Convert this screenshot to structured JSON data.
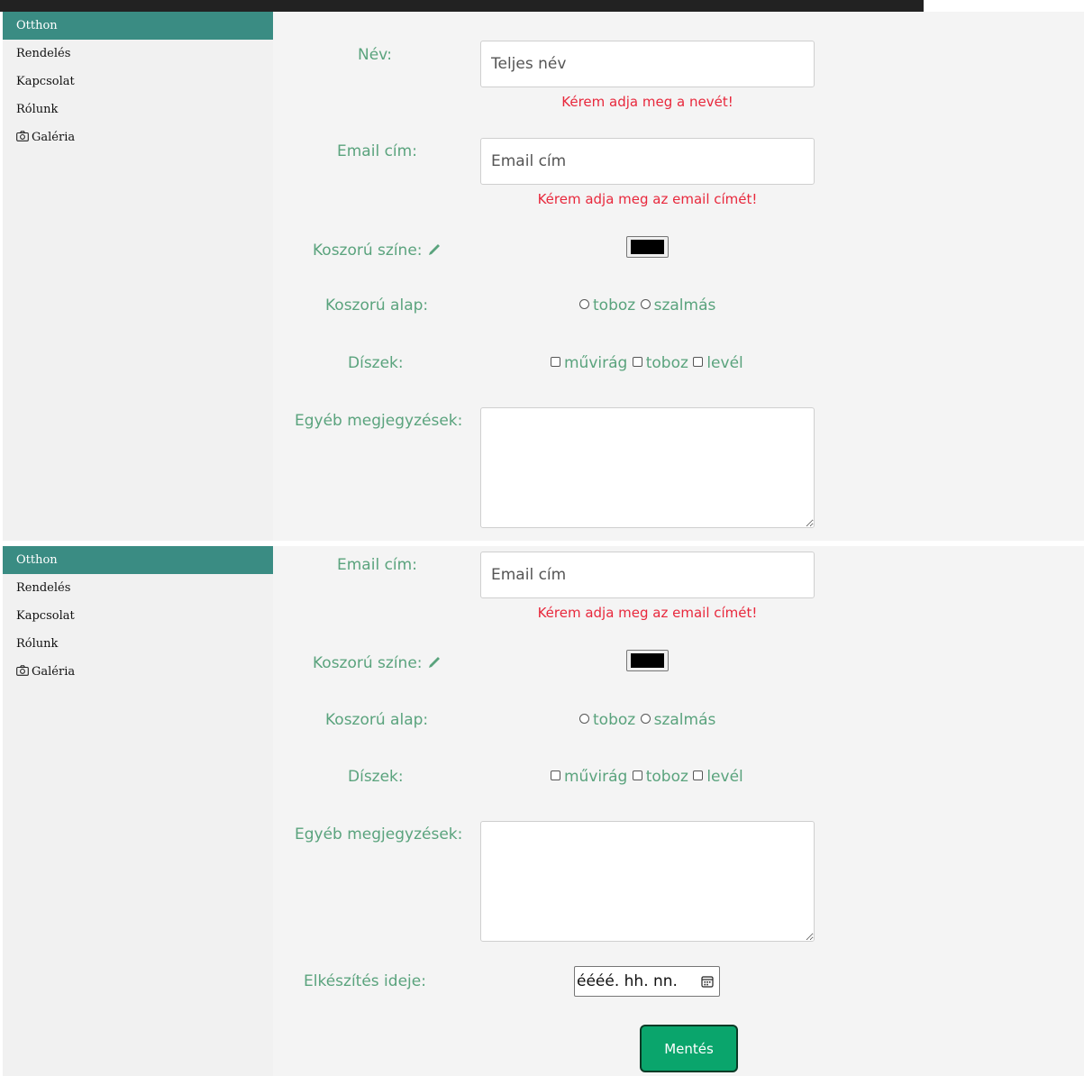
{
  "nav": {
    "items": [
      {
        "label": "Otthon",
        "active": true
      },
      {
        "label": "Rendelés",
        "active": false
      },
      {
        "label": "Kapcsolat",
        "active": false
      },
      {
        "label": "Rólunk",
        "active": false
      },
      {
        "label": "Galéria",
        "active": false,
        "icon": "camera-icon"
      }
    ]
  },
  "form": {
    "name_label": "Név:",
    "name_placeholder": "Teljes név",
    "name_error": "Kérem adja meg a nevét!",
    "email_label": "Email cím:",
    "email_placeholder": "Email cím",
    "email_error": "Kérem adja meg az email címét!",
    "color_label": "Koszorú színe:",
    "color_icon": "pencil-icon",
    "color_value": "#000000",
    "base_label": "Koszorú alap:",
    "base_options": [
      "toboz",
      "szalmás"
    ],
    "decor_label": "Díszek:",
    "decor_options": [
      "művirág",
      "toboz",
      "levél"
    ],
    "notes_label": "Egyéb megjegyzések:",
    "date_label": "Elkészítés ideje:",
    "date_placeholder": "éééé. hh. nn.",
    "date_icon": "calendar-icon",
    "save_label": "Mentés"
  },
  "colors": {
    "accent": "#3a8c83",
    "label": "#5aa37d",
    "error": "#e8283c",
    "button": "#0aa56c"
  }
}
